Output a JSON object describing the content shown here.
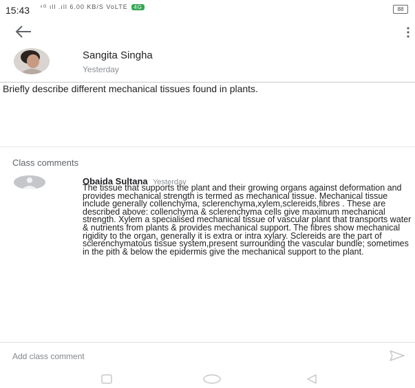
{
  "status_bar": {
    "time": "15:43",
    "signal_text": "⁴ᴳ ıll .ıll 6.00 KB/S VoLTE",
    "network_badge": "4G",
    "battery": "88"
  },
  "post": {
    "author": "Sangita Singha",
    "date": "Yesterday",
    "body": "Briefly describe different mechanical tissues found in plants."
  },
  "comments_header": "Class comments",
  "comments": [
    {
      "author": "Obaida Sultana",
      "date": "Yesterday",
      "text": "The tissue that supports the plant and their growing organs against deformation and provides mechanical strength is termed as mechanical tissue. Mechanical tissue include  generally collenchyma, sclerenchyma,xylem,sclereids,fibres . These are described above: collenchyma & sclerenchyma cells give maximum mechanical strength. Xylem a specialised mechanical tissue of vascular plant that transports water & nutrients from plants & provides mechanical support. The fibres show mechanical rigidity to the organ, generally it is extra or intra xylary. Sclereids are the part of sclerenchymatous tissue system,present surrounding the vascular bundle; sometimes in the pith & below the epidermis give the mechanical support to the plant."
    }
  ],
  "comment_input": {
    "placeholder": "Add class comment",
    "value": ""
  },
  "colors": {
    "divider": "#c8c8c8",
    "muted_text": "#8a8f94",
    "nav_icon": "#c7c7c7"
  }
}
